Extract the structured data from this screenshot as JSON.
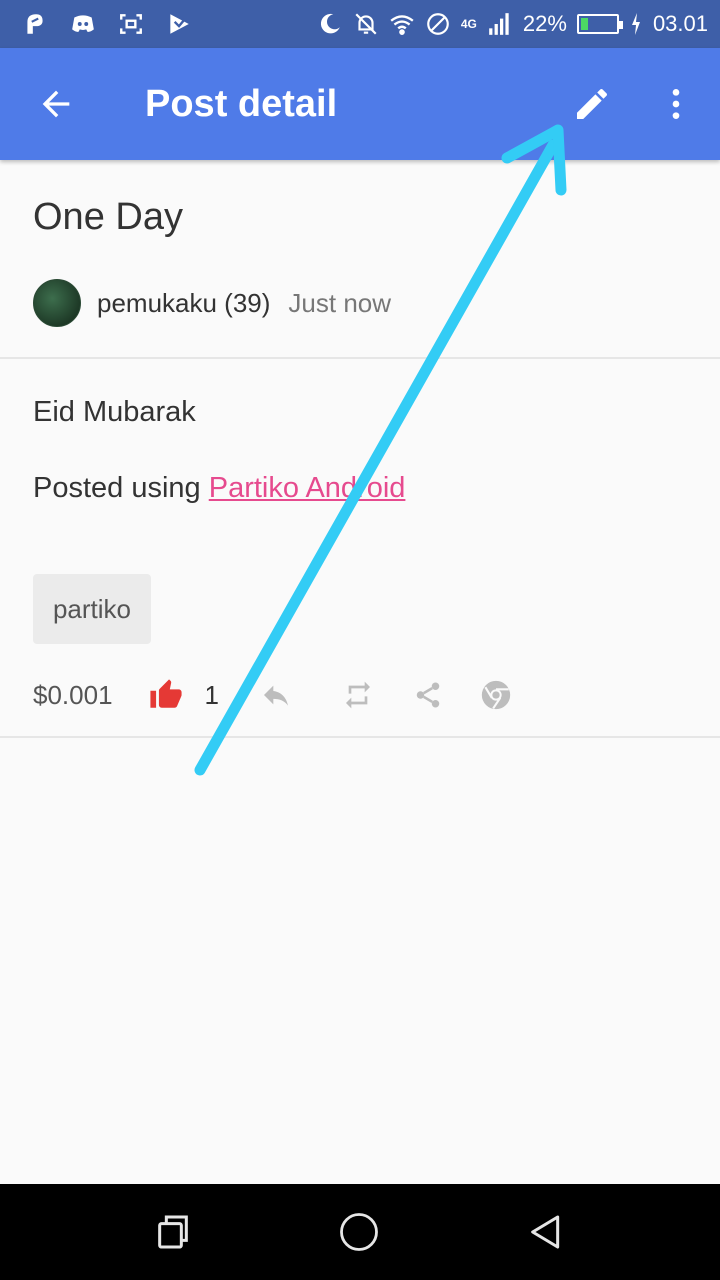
{
  "status_bar": {
    "network_type": "4G",
    "battery_percent": "22%",
    "battery_level": 0.22,
    "time": "03.01",
    "icons": [
      "app-notification-icon",
      "discord-icon",
      "screenshot-icon",
      "play-store-icon",
      "night-mode-icon",
      "mute-icon",
      "wifi-icon",
      "do-not-disturb-icon",
      "signal-icon",
      "battery-icon",
      "charging-icon"
    ]
  },
  "app_bar": {
    "title": "Post detail",
    "back_icon": "arrow-back-icon",
    "edit_icon": "pencil-icon",
    "more_icon": "more-vert-icon"
  },
  "post": {
    "title": "One Day",
    "author": "pemukaku (39)",
    "time": "Just now",
    "body": "Eid Mubarak",
    "posted_using_prefix": "Posted using ",
    "posted_using_link": "Partiko Android",
    "tag": "partiko",
    "payout": "$0.001",
    "like_count": "1"
  },
  "colors": {
    "app_bar": "#4f7be8",
    "status_bar": "#3e5fa8",
    "link": "#e64a8e",
    "like": "#e53935",
    "annotation_arrow": "#33ccf5"
  }
}
